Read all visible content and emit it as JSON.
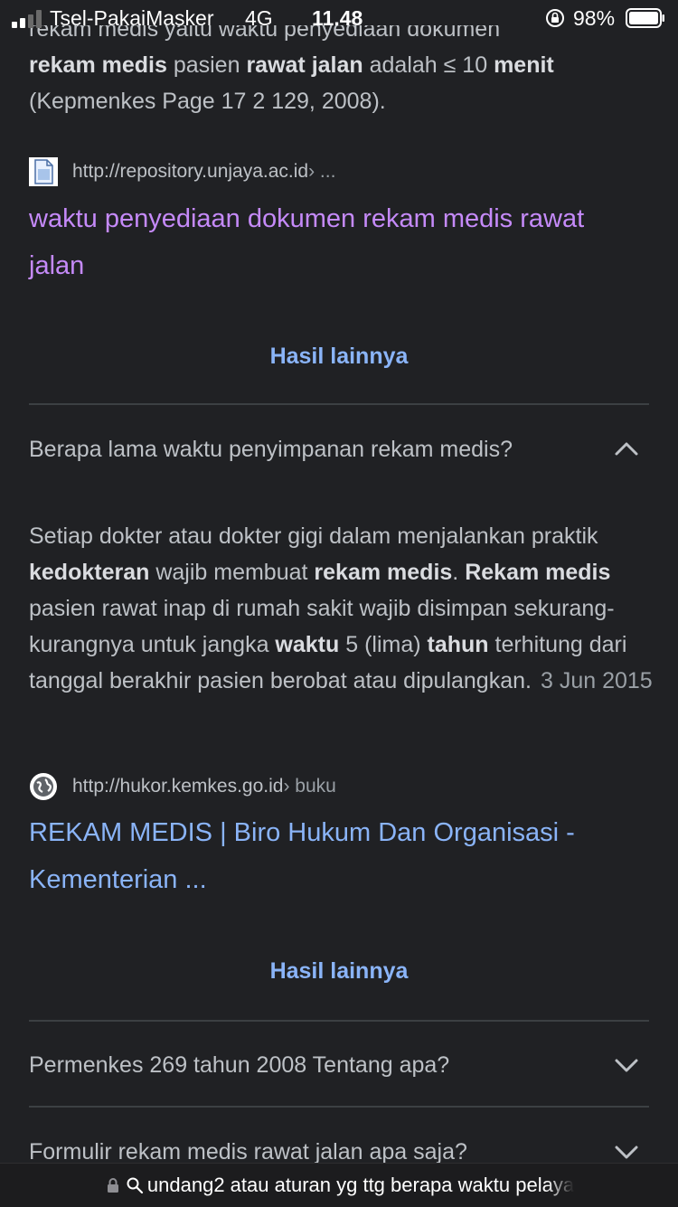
{
  "status_bar": {
    "carrier": "Tsel-PakaiMasker",
    "network": "4G",
    "time": "11.48",
    "battery": "98%"
  },
  "top_snippet": {
    "cut_line": "rekam medis yaitu waktu penyediaan dokumen",
    "s1_b": "rekam medis",
    "s2": " pasien ",
    "s3_b": "rawat jalan",
    "s4": " adalah ≤ 10 ",
    "s5_b": "menit",
    "s6": "(Kepmenkes Page 17 2 129, 2008)."
  },
  "result1": {
    "source_url": "http://repository.unjaya.ac.id",
    "source_crumb": " › ...",
    "title": "waktu penyediaan dokumen rekam medis rawat jalan",
    "favicon": "document-icon"
  },
  "more1": "Hasil lainnya",
  "faq1": {
    "question": "Berapa lama waktu penyimpanan rekam medis?",
    "icon": "chevron-up-icon",
    "answer": {
      "a1": "Setiap dokter atau dokter gigi dalam menjalankan praktik ",
      "a2_b": "kedokteran",
      "a3": " wajib membuat ",
      "a4_b": "rekam medis",
      "a5": ". ",
      "a6_b": "Rekam medis",
      "a7": " pasien rawat inap di rumah sakit wajib disimpan sekurang-kurangnya untuk jangka ",
      "a8_b": "waktu",
      "a9": " 5 (lima) ",
      "a10_b": "tahun",
      "a11": " terhitung dari tanggal berakhir pasien berobat atau dipulangkan.",
      "date": "3 Jun 2015"
    }
  },
  "result2": {
    "source_url": "http://hukor.kemkes.go.id",
    "source_crumb": " › buku",
    "title": "REKAM MEDIS | Biro Hukum Dan Organisasi - Kementerian ...",
    "favicon": "globe-icon"
  },
  "more2": "Hasil lainnya",
  "faq2": {
    "question": "Permenkes 269 tahun 2008 Tentang apa?",
    "icon": "chevron-down-icon"
  },
  "faq3": {
    "question": "Formulir rekam medis rawat jalan apa saja?",
    "icon": "chevron-down-icon"
  },
  "address_bar": {
    "url": "undang2 atau aturan yg ttg berapa waktu pelaya",
    "icons": [
      "lock-icon",
      "search-icon"
    ]
  },
  "colors": {
    "background": "#202124",
    "visited_link": "#c58af9",
    "link": "#8ab4f8"
  }
}
